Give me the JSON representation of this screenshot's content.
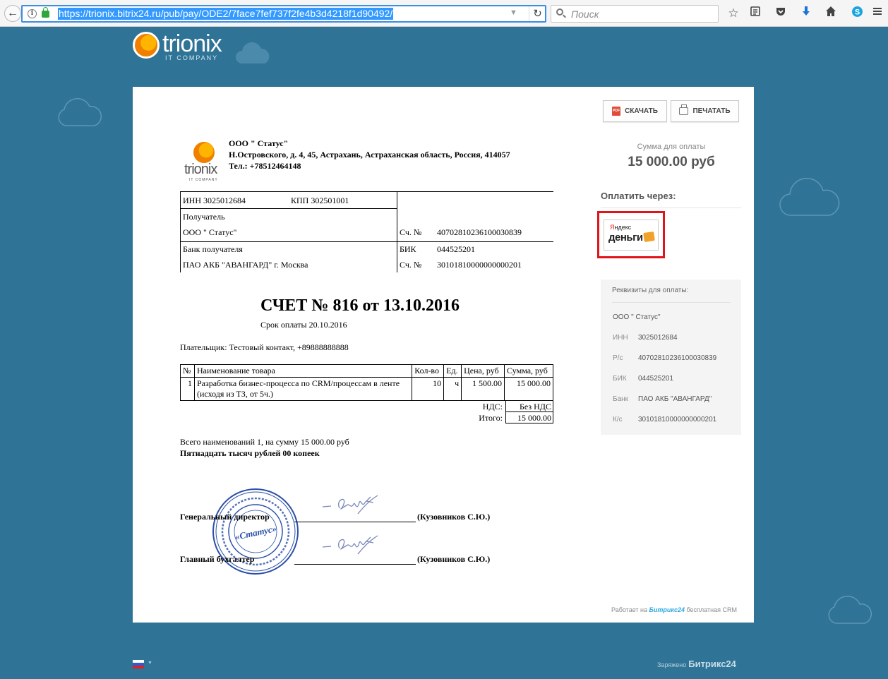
{
  "browser": {
    "url": "https://trionix.bitrix24.ru/pub/pay/ODE2/7face7fef737f2fe4b3d4218f1d90492/",
    "search_placeholder": "Поиск"
  },
  "header": {
    "logo_word": "trionix",
    "logo_sub": "IT COMPANY"
  },
  "actions": {
    "download_label": "СКАЧАТЬ",
    "print_label": "ПЕЧАТАТЬ"
  },
  "payment": {
    "sum_label": "Сумма для оплаты",
    "sum_value": "15 000.00 руб",
    "pay_via_label": "Оплатить через:",
    "yandex_top_red": "Я",
    "yandex_top_rest": "ндекс",
    "yandex_bottom": "деньги"
  },
  "requisites": {
    "title": "Реквизиты для оплаты:",
    "company": "ООО \" Статус\"",
    "rows": [
      {
        "label": "ИНН",
        "value": "3025012684"
      },
      {
        "label": "Р/с",
        "value": "40702810236100030839"
      },
      {
        "label": "БИК",
        "value": "044525201"
      },
      {
        "label": "Банк",
        "value": "ПАО АКБ \"АВАНГАРД\""
      },
      {
        "label": "К/с",
        "value": "30101810000000000201"
      }
    ]
  },
  "powered": {
    "prefix": "Работает на",
    "brand": "Битрикс24",
    "suffix": "бесплатная CRM"
  },
  "invoice": {
    "logo_word": "trionix",
    "logo_sub": "IT COMPANY",
    "company_name": "ООО \" Статус\"",
    "company_address": "Н.Островского, д. 4, 45, Астрахань, Астраханская область, Россия, 414057",
    "company_phone": "Тел.: +78512464148",
    "bank": {
      "inn": "ИНН 3025012684",
      "kpp": "КПП 302501001",
      "recipient_label": "Получатель",
      "recipient": "ООО \" Статус\"",
      "account_label": "Сч. №",
      "account": "40702810236100030839",
      "bank_label": "Банк получателя",
      "bank_name": "ПАО АКБ \"АВАНГАРД\" г. Москва",
      "bik_label": "БИК",
      "bik": "044525201",
      "corr_label": "Сч. №",
      "corr": "30101810000000000201"
    },
    "title": "СЧЕТ № 816 от 13.10.2016",
    "due": "Срок оплаты 20.10.2016",
    "payer": "Плательщик: Тестовый контакт, +89888888888",
    "columns": [
      "№",
      "Наименование товара",
      "Кол-во",
      "Ед.",
      "Цена, руб",
      "Сумма, руб"
    ],
    "items": [
      {
        "n": "1",
        "name": "Разработка бизнес-процесса по CRM/процессам в ленте (исходя из ТЗ, от 5ч.)",
        "qty": "10",
        "unit": "ч",
        "price": "1 500.00",
        "sum": "15 000.00"
      }
    ],
    "vat_label": "НДС:",
    "vat_value": "Без НДС",
    "total_label": "Итого:",
    "total_value": "15 000.00",
    "total_count": "Всего наименований 1, на сумму 15 000.00 руб",
    "total_words": "Пятнадцать тысяч рублей 00 копеек",
    "director_label": "Генеральный директор",
    "director_name": "(Кузовников С.Ю.)",
    "accountant_label": "Главный бухгалтер",
    "accountant_name": "(Кузовников С.Ю.)",
    "stamp_center": "«Статус»"
  },
  "footer": {
    "charged_label": "Заряжено",
    "brand": "Битрикс24"
  }
}
